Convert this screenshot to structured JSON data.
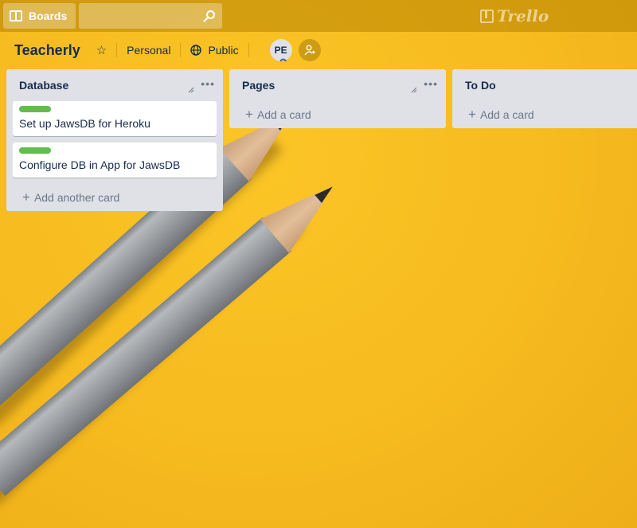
{
  "header": {
    "boards_label": "Boards",
    "search_value": "",
    "logo_text": "Trello"
  },
  "boardbar": {
    "title": "Teacherly",
    "visibility_team": "Personal",
    "visibility_public": "Public",
    "member_initials": "PE"
  },
  "lists": [
    {
      "title": "Database",
      "cards": [
        {
          "text": "Set up JawsDB for Heroku",
          "label_color": "#61bd4f"
        },
        {
          "text": "Configure DB in App for JawsDB",
          "label_color": "#61bd4f"
        }
      ],
      "add_label": "Add another card"
    },
    {
      "title": "Pages",
      "cards": [],
      "add_label": "Add a card"
    },
    {
      "title": "To Do",
      "cards": [],
      "add_label": "Add a card"
    }
  ],
  "colors": {
    "background": "#f3b620",
    "list_bg": "#dfe1e6",
    "label_green": "#61bd4f"
  }
}
